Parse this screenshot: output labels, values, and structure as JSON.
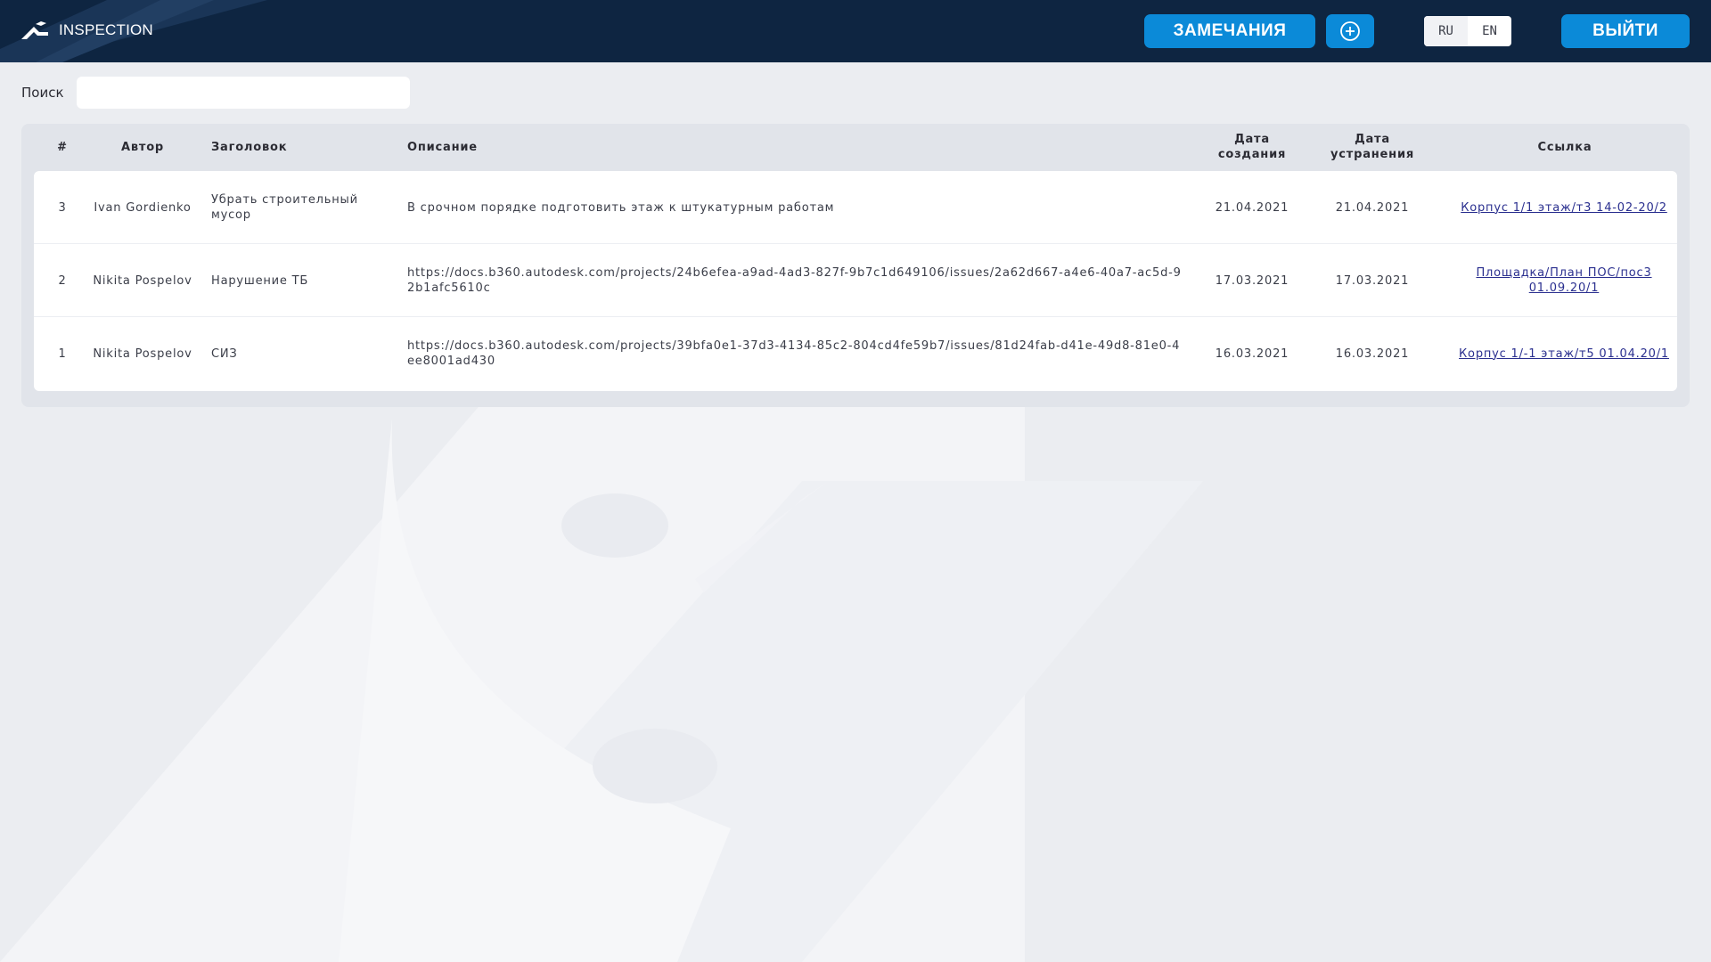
{
  "header": {
    "brand": "INSPECTION",
    "remarks_button": "ЗАМЕЧАНИЯ",
    "add_button_icon": "plus-circle-icon",
    "lang_options": [
      "RU",
      "EN"
    ],
    "lang_active": "RU",
    "logout_button": "ВЫЙТИ"
  },
  "search": {
    "label": "Поиск",
    "value": "",
    "placeholder": ""
  },
  "table": {
    "columns": {
      "num": "#",
      "author": "Автор",
      "title": "Заголовок",
      "description": "Описание",
      "created": "Дата создания",
      "fixed": "Дата устранения",
      "link": "Ссылка"
    },
    "rows": [
      {
        "num": "3",
        "author": "Ivan Gordienko",
        "title": "Убрать строительный мусор",
        "description": "В срочном порядке подготовить этаж к штукатурным работам",
        "created": "21.04.2021",
        "fixed": "21.04.2021",
        "link": "Корпус 1/1 этаж/т3 14-02-20/2"
      },
      {
        "num": "2",
        "author": "Nikita Pospelov",
        "title": "Нарушение ТБ",
        "description": "https://docs.b360.autodesk.com/projects/24b6efea-a9ad-4ad3-827f-9b7c1d649106/issues/2a62d667-a4e6-40a7-ac5d-92b1afc5610c",
        "created": "17.03.2021",
        "fixed": "17.03.2021",
        "link": "Площадка/План ПОС/пос3 01.09.20/1"
      },
      {
        "num": "1",
        "author": "Nikita Pospelov",
        "title": "СИЗ",
        "description": "https://docs.b360.autodesk.com/projects/39bfa0e1-37d3-4134-85c2-804cd4fe59b7/issues/81d24fab-d41e-49d8-81e0-4ee8001ad430",
        "created": "16.03.2021",
        "fixed": "16.03.2021",
        "link": "Корпус 1/-1 этаж/т5 01.04.20/1"
      }
    ]
  },
  "colors": {
    "header_bg": "#0e2541",
    "accent": "#0b8ad8",
    "page_bg": "#ebedf1",
    "link": "#2a2f8f"
  }
}
